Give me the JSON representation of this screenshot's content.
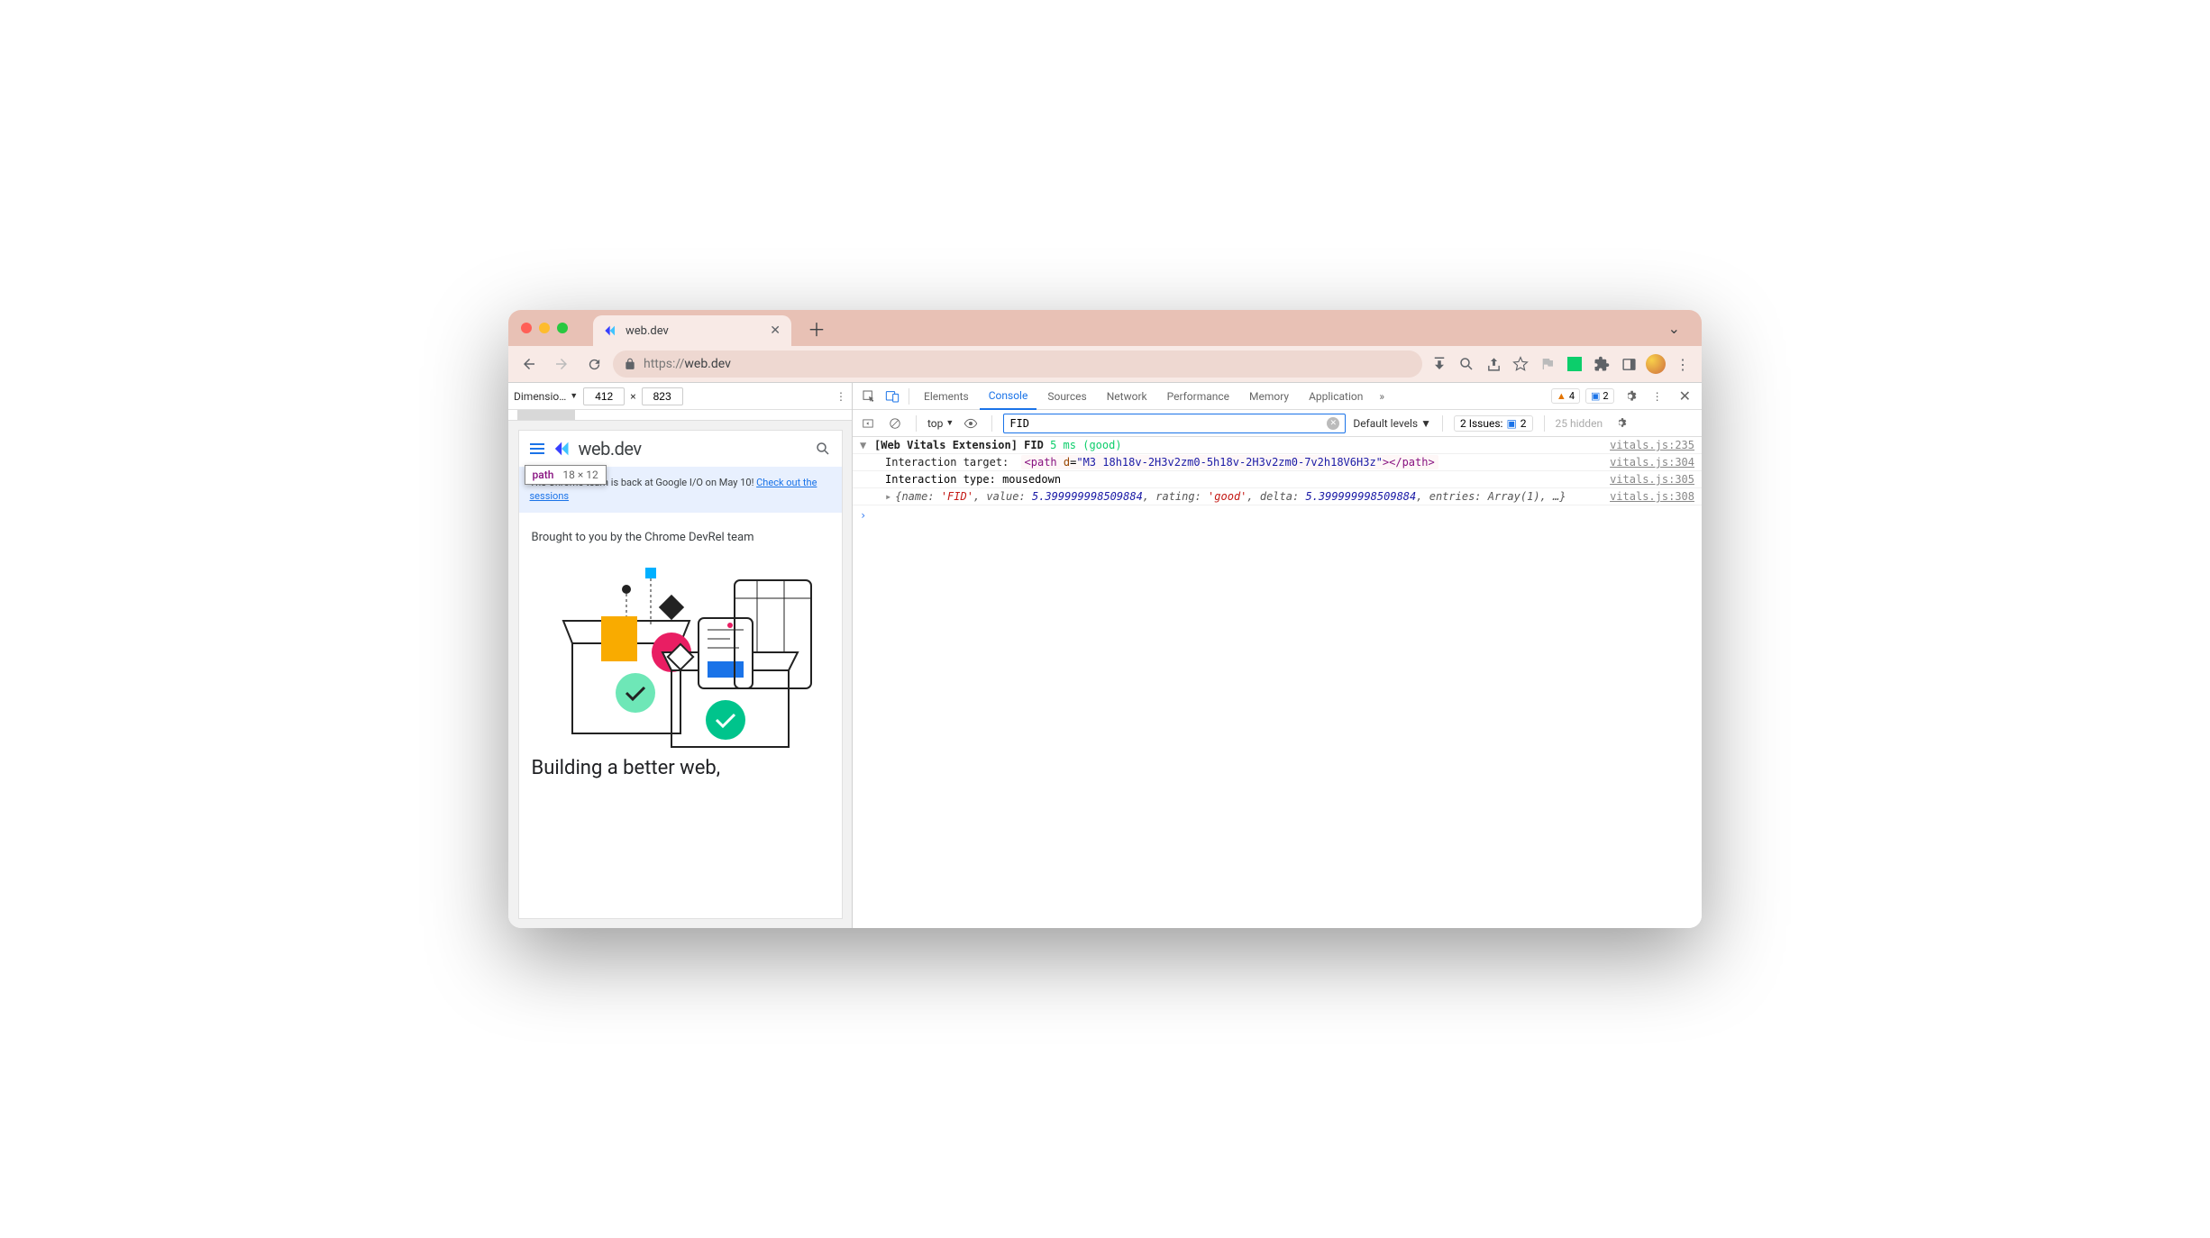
{
  "chrome": {
    "tab_title": "web.dev",
    "url_scheme": "https://",
    "url_host": "web.dev"
  },
  "device_toolbar": {
    "label": "Dimensio…",
    "width": "412",
    "height": "823"
  },
  "tooltip": {
    "element": "path",
    "size": "18 × 12"
  },
  "page": {
    "title": "web.dev",
    "banner_pre": "The Chrome team is back at Google I/O on May 10! ",
    "banner_link": "Check out the sessions",
    "brought": "Brought to you by the Chrome DevRel team",
    "headline": "Building a better web,"
  },
  "devtools": {
    "tabs": [
      "Elements",
      "Console",
      "Sources",
      "Network",
      "Performance",
      "Memory",
      "Application"
    ],
    "active_tab": "Console",
    "warn_count": "4",
    "msg_count": "2"
  },
  "console_toolbar": {
    "context": "top",
    "filter": "FID",
    "levels": "Default levels",
    "issues_label": "2 Issues:",
    "issues_count": "2",
    "hidden": "25 hidden"
  },
  "log": {
    "l1_prefix": "[Web Vitals Extension] FID",
    "l1_time": "5 ms",
    "l1_rating": "(good)",
    "l1_src": "vitals.js:235",
    "l2_label": "Interaction target:",
    "l2_tag_open": "<path",
    "l2_attr": "d",
    "l2_str": "\"M3 18h18v-2H3v2zm0-5h18v-2H3v2zm0-7v2h18V6H3z\"",
    "l2_tag_close": "></path>",
    "l2_src": "vitals.js:304",
    "l3_label": "Interaction type:",
    "l3_val": "mousedown",
    "l3_src": "vitals.js:305",
    "l4_obj": "{name: 'FID', value: 5.399999998509884, rating: 'good', delta: 5.399999998509884, entries: Array(1), …}",
    "l4_src": "vitals.js:308"
  }
}
